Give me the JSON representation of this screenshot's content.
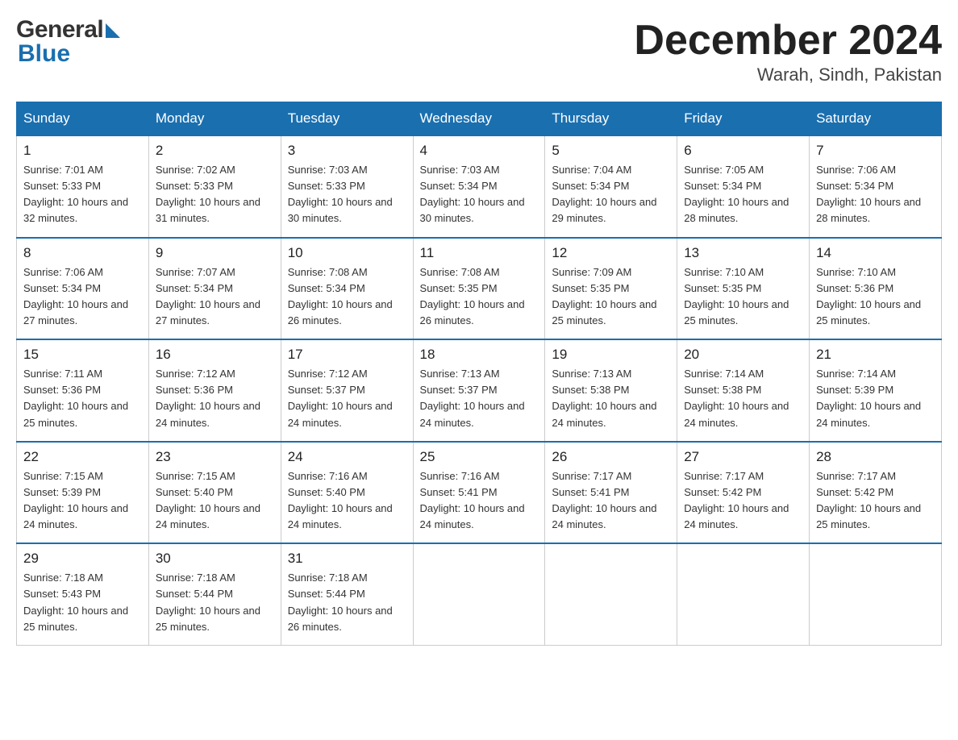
{
  "header": {
    "month_title": "December 2024",
    "location": "Warah, Sindh, Pakistan",
    "logo_general": "General",
    "logo_blue": "Blue"
  },
  "columns": [
    "Sunday",
    "Monday",
    "Tuesday",
    "Wednesday",
    "Thursday",
    "Friday",
    "Saturday"
  ],
  "weeks": [
    [
      {
        "day": "1",
        "sunrise": "7:01 AM",
        "sunset": "5:33 PM",
        "daylight": "10 hours and 32 minutes."
      },
      {
        "day": "2",
        "sunrise": "7:02 AM",
        "sunset": "5:33 PM",
        "daylight": "10 hours and 31 minutes."
      },
      {
        "day": "3",
        "sunrise": "7:03 AM",
        "sunset": "5:33 PM",
        "daylight": "10 hours and 30 minutes."
      },
      {
        "day": "4",
        "sunrise": "7:03 AM",
        "sunset": "5:34 PM",
        "daylight": "10 hours and 30 minutes."
      },
      {
        "day": "5",
        "sunrise": "7:04 AM",
        "sunset": "5:34 PM",
        "daylight": "10 hours and 29 minutes."
      },
      {
        "day": "6",
        "sunrise": "7:05 AM",
        "sunset": "5:34 PM",
        "daylight": "10 hours and 28 minutes."
      },
      {
        "day": "7",
        "sunrise": "7:06 AM",
        "sunset": "5:34 PM",
        "daylight": "10 hours and 28 minutes."
      }
    ],
    [
      {
        "day": "8",
        "sunrise": "7:06 AM",
        "sunset": "5:34 PM",
        "daylight": "10 hours and 27 minutes."
      },
      {
        "day": "9",
        "sunrise": "7:07 AM",
        "sunset": "5:34 PM",
        "daylight": "10 hours and 27 minutes."
      },
      {
        "day": "10",
        "sunrise": "7:08 AM",
        "sunset": "5:34 PM",
        "daylight": "10 hours and 26 minutes."
      },
      {
        "day": "11",
        "sunrise": "7:08 AM",
        "sunset": "5:35 PM",
        "daylight": "10 hours and 26 minutes."
      },
      {
        "day": "12",
        "sunrise": "7:09 AM",
        "sunset": "5:35 PM",
        "daylight": "10 hours and 25 minutes."
      },
      {
        "day": "13",
        "sunrise": "7:10 AM",
        "sunset": "5:35 PM",
        "daylight": "10 hours and 25 minutes."
      },
      {
        "day": "14",
        "sunrise": "7:10 AM",
        "sunset": "5:36 PM",
        "daylight": "10 hours and 25 minutes."
      }
    ],
    [
      {
        "day": "15",
        "sunrise": "7:11 AM",
        "sunset": "5:36 PM",
        "daylight": "10 hours and 25 minutes."
      },
      {
        "day": "16",
        "sunrise": "7:12 AM",
        "sunset": "5:36 PM",
        "daylight": "10 hours and 24 minutes."
      },
      {
        "day": "17",
        "sunrise": "7:12 AM",
        "sunset": "5:37 PM",
        "daylight": "10 hours and 24 minutes."
      },
      {
        "day": "18",
        "sunrise": "7:13 AM",
        "sunset": "5:37 PM",
        "daylight": "10 hours and 24 minutes."
      },
      {
        "day": "19",
        "sunrise": "7:13 AM",
        "sunset": "5:38 PM",
        "daylight": "10 hours and 24 minutes."
      },
      {
        "day": "20",
        "sunrise": "7:14 AM",
        "sunset": "5:38 PM",
        "daylight": "10 hours and 24 minutes."
      },
      {
        "day": "21",
        "sunrise": "7:14 AM",
        "sunset": "5:39 PM",
        "daylight": "10 hours and 24 minutes."
      }
    ],
    [
      {
        "day": "22",
        "sunrise": "7:15 AM",
        "sunset": "5:39 PM",
        "daylight": "10 hours and 24 minutes."
      },
      {
        "day": "23",
        "sunrise": "7:15 AM",
        "sunset": "5:40 PM",
        "daylight": "10 hours and 24 minutes."
      },
      {
        "day": "24",
        "sunrise": "7:16 AM",
        "sunset": "5:40 PM",
        "daylight": "10 hours and 24 minutes."
      },
      {
        "day": "25",
        "sunrise": "7:16 AM",
        "sunset": "5:41 PM",
        "daylight": "10 hours and 24 minutes."
      },
      {
        "day": "26",
        "sunrise": "7:17 AM",
        "sunset": "5:41 PM",
        "daylight": "10 hours and 24 minutes."
      },
      {
        "day": "27",
        "sunrise": "7:17 AM",
        "sunset": "5:42 PM",
        "daylight": "10 hours and 24 minutes."
      },
      {
        "day": "28",
        "sunrise": "7:17 AM",
        "sunset": "5:42 PM",
        "daylight": "10 hours and 25 minutes."
      }
    ],
    [
      {
        "day": "29",
        "sunrise": "7:18 AM",
        "sunset": "5:43 PM",
        "daylight": "10 hours and 25 minutes."
      },
      {
        "day": "30",
        "sunrise": "7:18 AM",
        "sunset": "5:44 PM",
        "daylight": "10 hours and 25 minutes."
      },
      {
        "day": "31",
        "sunrise": "7:18 AM",
        "sunset": "5:44 PM",
        "daylight": "10 hours and 26 minutes."
      },
      null,
      null,
      null,
      null
    ]
  ]
}
